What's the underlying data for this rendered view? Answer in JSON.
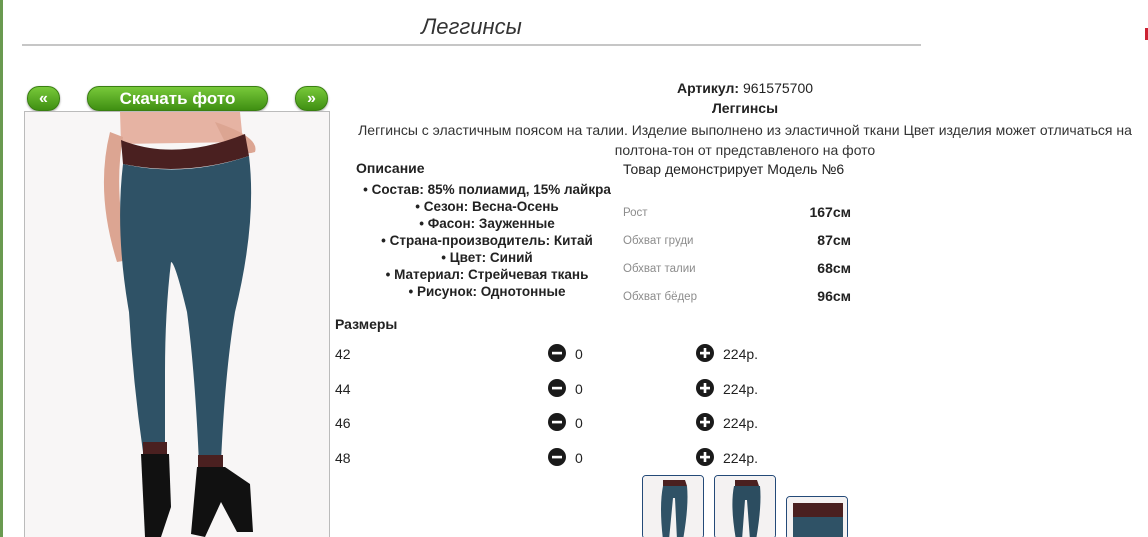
{
  "page": {
    "title": "Леггинсы"
  },
  "gallery": {
    "prev_label": "«",
    "download_label": "Скачать фото",
    "next_label": "»"
  },
  "product": {
    "article_label": "Артикул:",
    "article_value": "961575700",
    "name": "Леггинсы",
    "description": "Леггинсы с эластичным поясом на талии. Изделие выполнено из эластичной ткани Цвет изделия может отличаться на полтона-тон от представленого на фото"
  },
  "description_section": {
    "heading": "Описание",
    "items": [
      "Состав: 85% полиамид, 15% лайкра",
      "Сезон: Весна-Осень",
      "Фасон: Зауженные",
      "Страна-производитель: Китай",
      "Цвет: Синий",
      "Материал: Стрейчевая ткань",
      "Рисунок: Однотонные"
    ]
  },
  "model": {
    "heading": "Товар демонстрирует Модель №6",
    "measurements": [
      {
        "label": "Рост",
        "value": "167см"
      },
      {
        "label": "Обхват груди",
        "value": "87см"
      },
      {
        "label": "Обхват талии",
        "value": "68см"
      },
      {
        "label": "Обхват бёдер",
        "value": "96см"
      }
    ]
  },
  "sizes": {
    "heading": "Размеры",
    "rows": [
      {
        "size": "42",
        "qty": "0",
        "price": "224р."
      },
      {
        "size": "44",
        "qty": "0",
        "price": "224р."
      },
      {
        "size": "46",
        "qty": "0",
        "price": "224р."
      },
      {
        "size": "48",
        "qty": "0",
        "price": "224р."
      }
    ]
  },
  "colors": {
    "accent_green": "#4da01c",
    "leggings_blue": "#2f5266",
    "waistband": "#4a2020",
    "thumb_border": "#244a78"
  },
  "icons": {
    "minus": "minus-circle-icon",
    "plus": "plus-circle-icon"
  }
}
